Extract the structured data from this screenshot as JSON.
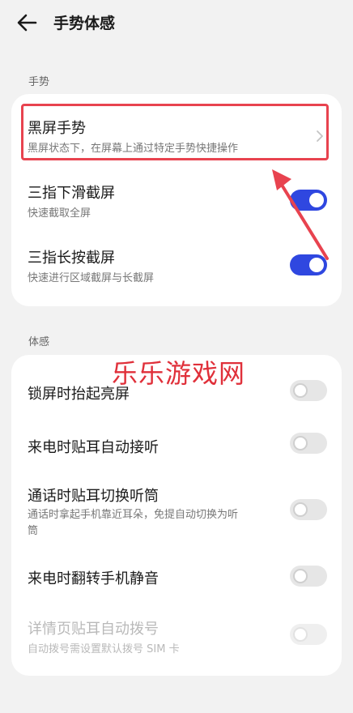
{
  "header": {
    "title": "手势体感"
  },
  "gesture_section": {
    "label": "手势",
    "items": [
      {
        "title": "黑屏手势",
        "subtitle": "黑屏状态下，在屏幕上通过特定手势快捷操作"
      },
      {
        "title": "三指下滑截屏",
        "subtitle": "快速截取全屏",
        "enabled": true
      },
      {
        "title": "三指长按截屏",
        "subtitle": "快速进行区域截屏与长截屏",
        "enabled": true
      }
    ]
  },
  "motion_section": {
    "label": "体感",
    "items": [
      {
        "title": "锁屏时抬起亮屏",
        "enabled": false
      },
      {
        "title": "来电时贴耳自动接听",
        "enabled": false
      },
      {
        "title": "通话时贴耳切换听筒",
        "subtitle_line1": "通话时拿起手机靠近耳朵，免提自动切换为听",
        "subtitle_line2": "筒",
        "enabled": false
      },
      {
        "title": "来电时翻转手机静音",
        "enabled": false
      },
      {
        "title": "详情页贴耳自动拨号",
        "subtitle": "自动拨号需设置默认拨号 SIM 卡",
        "enabled": false,
        "disabled": true
      }
    ]
  },
  "watermark": "乐乐游戏网",
  "colors": {
    "accent": "#2f47e0",
    "highlight": "#e8434f",
    "watermark": "#e0303a"
  }
}
